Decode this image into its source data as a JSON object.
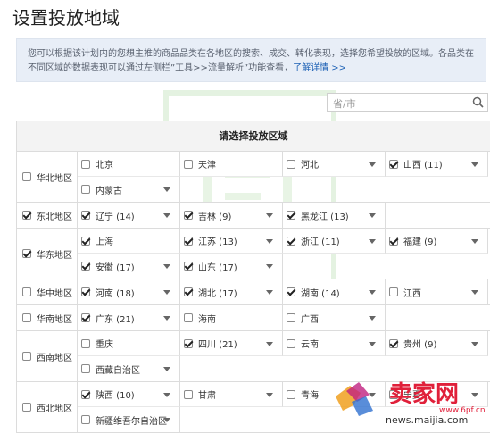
{
  "title": "设置投放地域",
  "notice": {
    "text": "您可以根据该计划内的您想主推的商品品类在各地区的搜索、成交、转化表现，选择您希望投放的区域。各品类在不同区域的数据表现可以通过左侧栏”工具>>流量解析”功能查看，",
    "link": "了解详情 >>"
  },
  "search": {
    "placeholder": "省/市"
  },
  "table_header": "请选择投放区域",
  "regions": [
    {
      "name": "华北地区",
      "checked": false,
      "provinces": [
        {
          "label": "北京",
          "checked": false,
          "dropdown": false
        },
        {
          "label": "天津",
          "checked": false,
          "dropdown": false
        },
        {
          "label": "河北",
          "checked": false,
          "dropdown": true
        },
        {
          "label": "山西 (11)",
          "checked": true,
          "dropdown": true
        },
        {
          "label": "内蒙古",
          "checked": false,
          "dropdown": true
        }
      ]
    },
    {
      "name": "东北地区",
      "checked": true,
      "provinces": [
        {
          "label": "辽宁 (14)",
          "checked": true,
          "dropdown": true
        },
        {
          "label": "吉林 (9)",
          "checked": true,
          "dropdown": true
        },
        {
          "label": "黑龙江 (13)",
          "checked": true,
          "dropdown": true
        }
      ]
    },
    {
      "name": "华东地区",
      "checked": true,
      "provinces": [
        {
          "label": "上海",
          "checked": true,
          "dropdown": false
        },
        {
          "label": "江苏 (13)",
          "checked": true,
          "dropdown": true
        },
        {
          "label": "浙江 (11)",
          "checked": true,
          "dropdown": true
        },
        {
          "label": "福建 (9)",
          "checked": true,
          "dropdown": true
        },
        {
          "label": "安徽 (17)",
          "checked": true,
          "dropdown": true
        },
        {
          "label": "山东 (17)",
          "checked": true,
          "dropdown": true
        }
      ]
    },
    {
      "name": "华中地区",
      "checked": false,
      "provinces": [
        {
          "label": "河南 (18)",
          "checked": true,
          "dropdown": true
        },
        {
          "label": "湖北 (17)",
          "checked": true,
          "dropdown": true
        },
        {
          "label": "湖南 (14)",
          "checked": true,
          "dropdown": true
        },
        {
          "label": "江西",
          "checked": false,
          "dropdown": true
        }
      ]
    },
    {
      "name": "华南地区",
      "checked": false,
      "provinces": [
        {
          "label": "广东 (21)",
          "checked": true,
          "dropdown": true
        },
        {
          "label": "海南",
          "checked": false,
          "dropdown": false
        },
        {
          "label": "广西",
          "checked": false,
          "dropdown": true
        }
      ]
    },
    {
      "name": "西南地区",
      "checked": false,
      "provinces": [
        {
          "label": "重庆",
          "checked": false,
          "dropdown": false
        },
        {
          "label": "四川 (21)",
          "checked": true,
          "dropdown": true
        },
        {
          "label": "云南",
          "checked": false,
          "dropdown": true
        },
        {
          "label": "贵州 (9)",
          "checked": true,
          "dropdown": true
        },
        {
          "label": "西藏自治区",
          "checked": false,
          "dropdown": true
        }
      ]
    },
    {
      "name": "西北地区",
      "checked": false,
      "provinces": [
        {
          "label": "陕西 (10)",
          "checked": true,
          "dropdown": true
        },
        {
          "label": "甘肃",
          "checked": false,
          "dropdown": true
        },
        {
          "label": "青海",
          "checked": false,
          "dropdown": true
        },
        {
          "label": "宁夏",
          "checked": false,
          "dropdown": true
        },
        {
          "label": "新疆维吾尔自治区",
          "checked": false,
          "dropdown": true
        }
      ]
    }
  ],
  "watermark": {
    "text": "鲁油宝",
    "color": "#8fc98a"
  },
  "corner_logo": {
    "text": "卖家网",
    "url_text": "news.maijia.com",
    "sub_text": "www.6pf.cn",
    "color": "#e0203a"
  },
  "colors": {
    "link": "#1a5fb4",
    "notice_bg": "#e8eef7",
    "header_bg": "#f3f3f3"
  }
}
